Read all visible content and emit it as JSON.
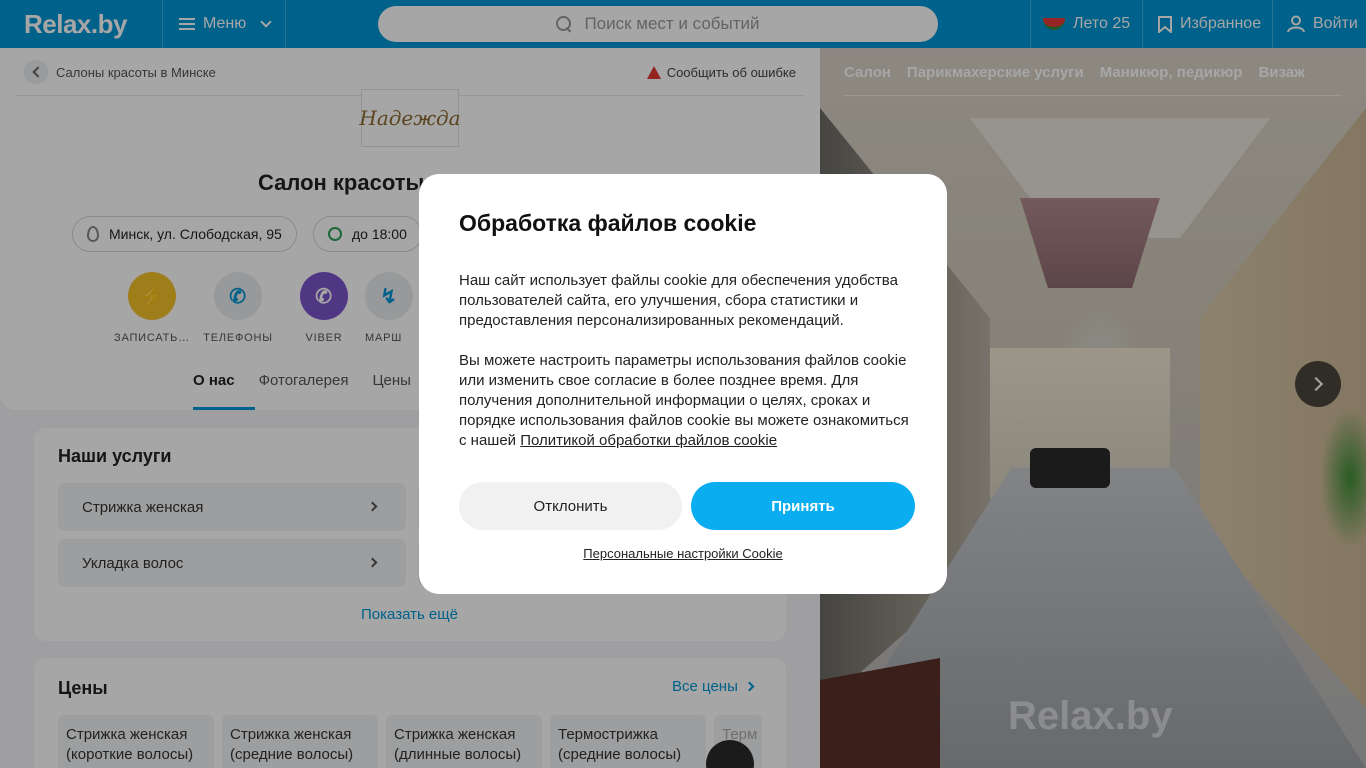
{
  "header": {
    "logo": "Relax.by",
    "menu_label": "Меню",
    "search_placeholder": "Поиск мест и событий",
    "summer_label": "Лето 25",
    "favorites_label": "Избранное",
    "login_label": "Войти"
  },
  "page": {
    "breadcrumb": "Салоны красоты в Минске",
    "report_error": "Сообщить об ошибке",
    "salon_logo_text": "Надежда",
    "title": "Салон красоты «Н",
    "address": "Минск, ул. Слободская, 95",
    "hours": "до 18:00",
    "actions": [
      {
        "label": "ЗАПИСАТЬ…",
        "icon": "lightning-icon",
        "color": "#f5c02a"
      },
      {
        "label": "ТЕЛЕФОНЫ",
        "icon": "phone-icon",
        "color": "#e9ecef"
      },
      {
        "label": "VIBER",
        "icon": "viber-icon",
        "color": "#7c55c9"
      },
      {
        "label": "МАРШ",
        "icon": "route-icon",
        "color": "#e9ecef"
      }
    ],
    "tabs": [
      "О нас",
      "Фотогалерея",
      "Цены"
    ]
  },
  "services": {
    "title": "Наши услуги",
    "items": [
      "Стрижка женская",
      "Укладка волос"
    ],
    "show_more": "Показать ещё"
  },
  "prices": {
    "title": "Цены",
    "all_prices": "Все цены",
    "items": [
      "Стрижка женская (короткие волосы)",
      "Стрижка женская (средние волосы)",
      "Стрижка женская (длинные волосы)",
      "Термострижка (средние волосы)",
      "Терм"
    ]
  },
  "gallery": {
    "tabs": [
      "Салон",
      "Парикмахерские услуги",
      "Маникюр, педикюр",
      "Визаж"
    ],
    "watermark": "Relax.by"
  },
  "cookie_modal": {
    "title": "Обработка файлов cookie",
    "paragraph1": "Наш сайт использует файлы cookie для обеспечения удобства пользователей сайта, его улучшения, сбора статистики и предоставления персонализированных рекомендаций.",
    "paragraph2": "Вы можете настроить параметры использования файлов cookie или изменить свое согласие в более позднее время. Для получения дополнительной информации о целях, сроках и порядке использования файлов cookie вы можете ознакомиться с нашей",
    "policy_link": "Политикой обработки файлов cookie",
    "decline": "Отклонить",
    "accept": "Принять",
    "settings_link": "Персональные настройки Cookie"
  }
}
